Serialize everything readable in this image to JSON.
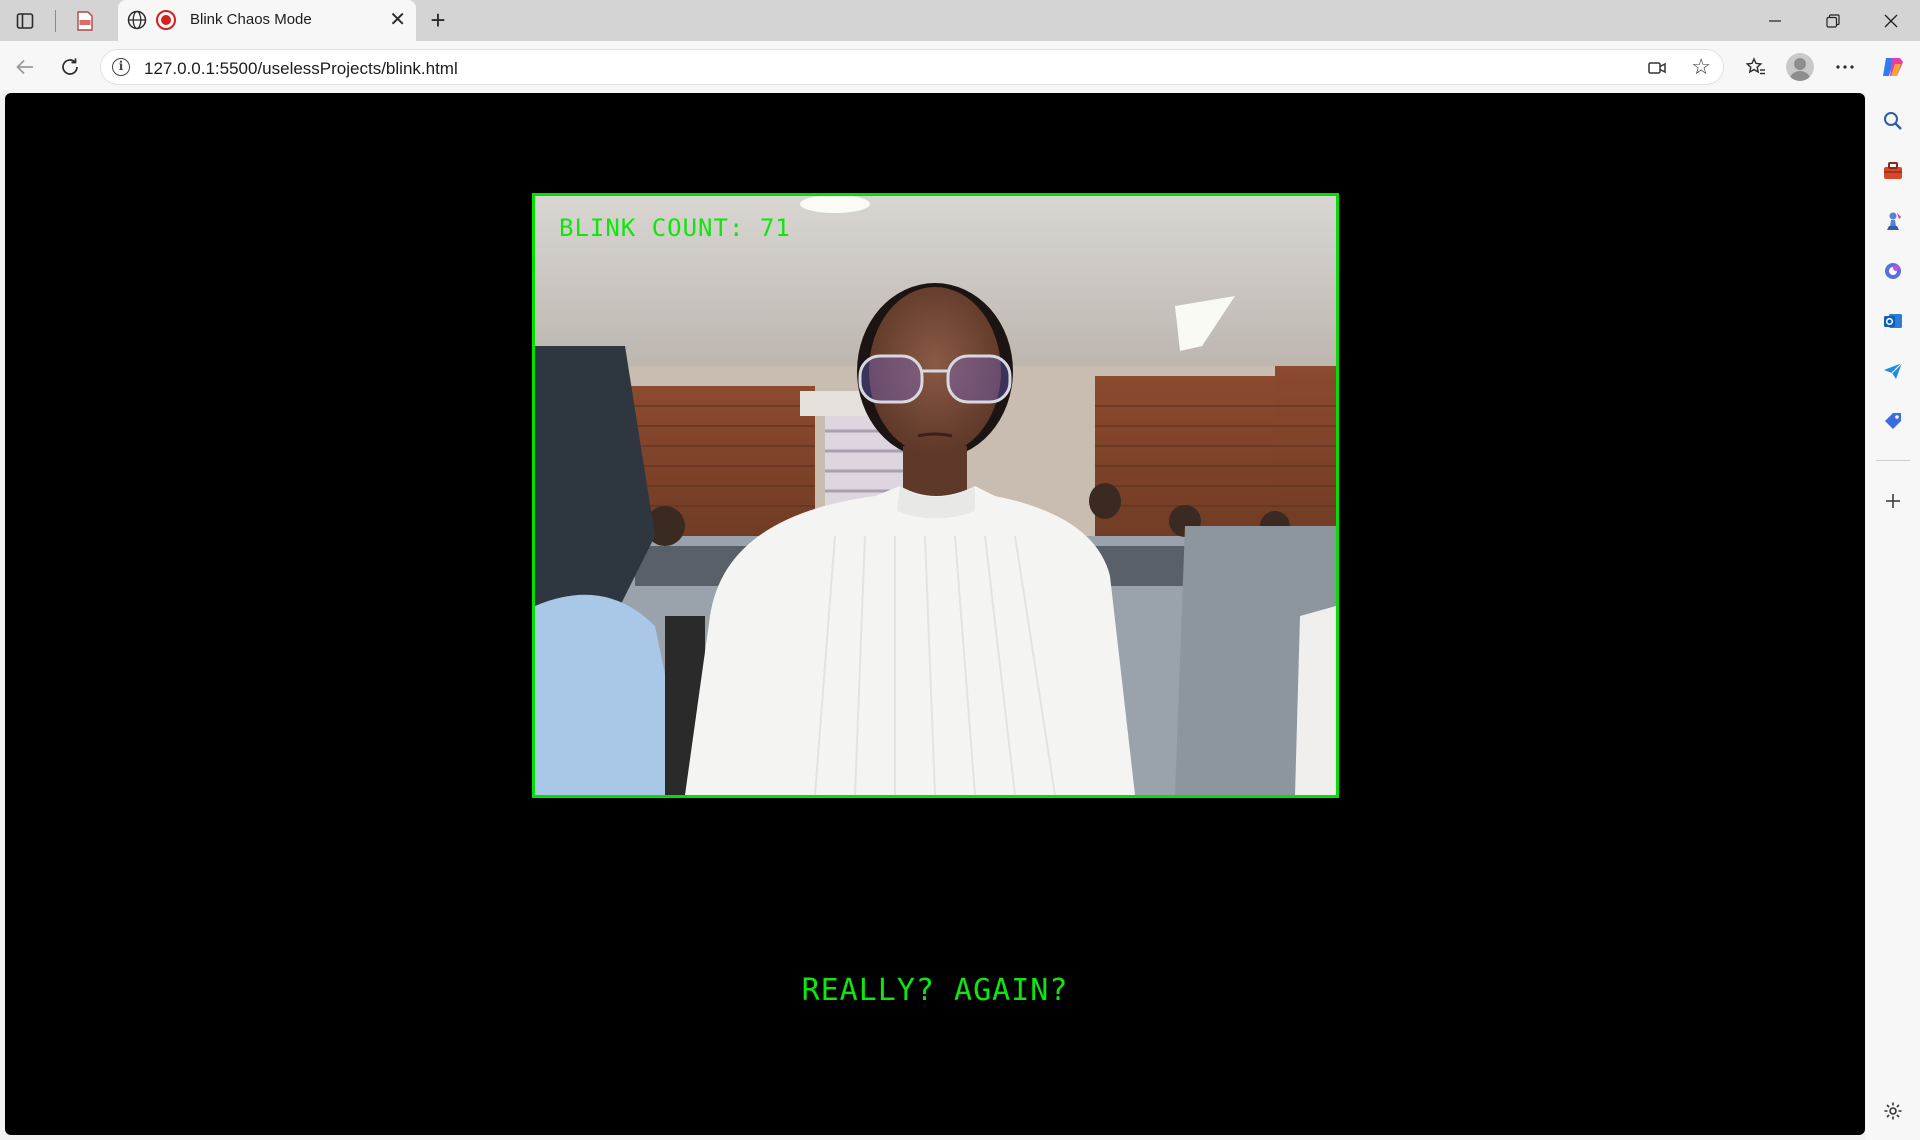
{
  "browser": {
    "tab": {
      "title": "Blink Chaos Mode"
    },
    "address": {
      "url": "127.0.0.1:5500/uselessProjects/blink.html"
    }
  },
  "page": {
    "counter_label": "BLINK COUNT: 71",
    "message": "REALLY? AGAIN?",
    "accent_color": "#00e100",
    "background_color": "#000000"
  },
  "sidebar": {
    "items": [
      "search-icon",
      "toolbox-icon",
      "chess-icon",
      "copilot-icon",
      "outlook-icon",
      "send-icon",
      "tag-icon",
      "add-icon",
      "settings-icon"
    ]
  }
}
